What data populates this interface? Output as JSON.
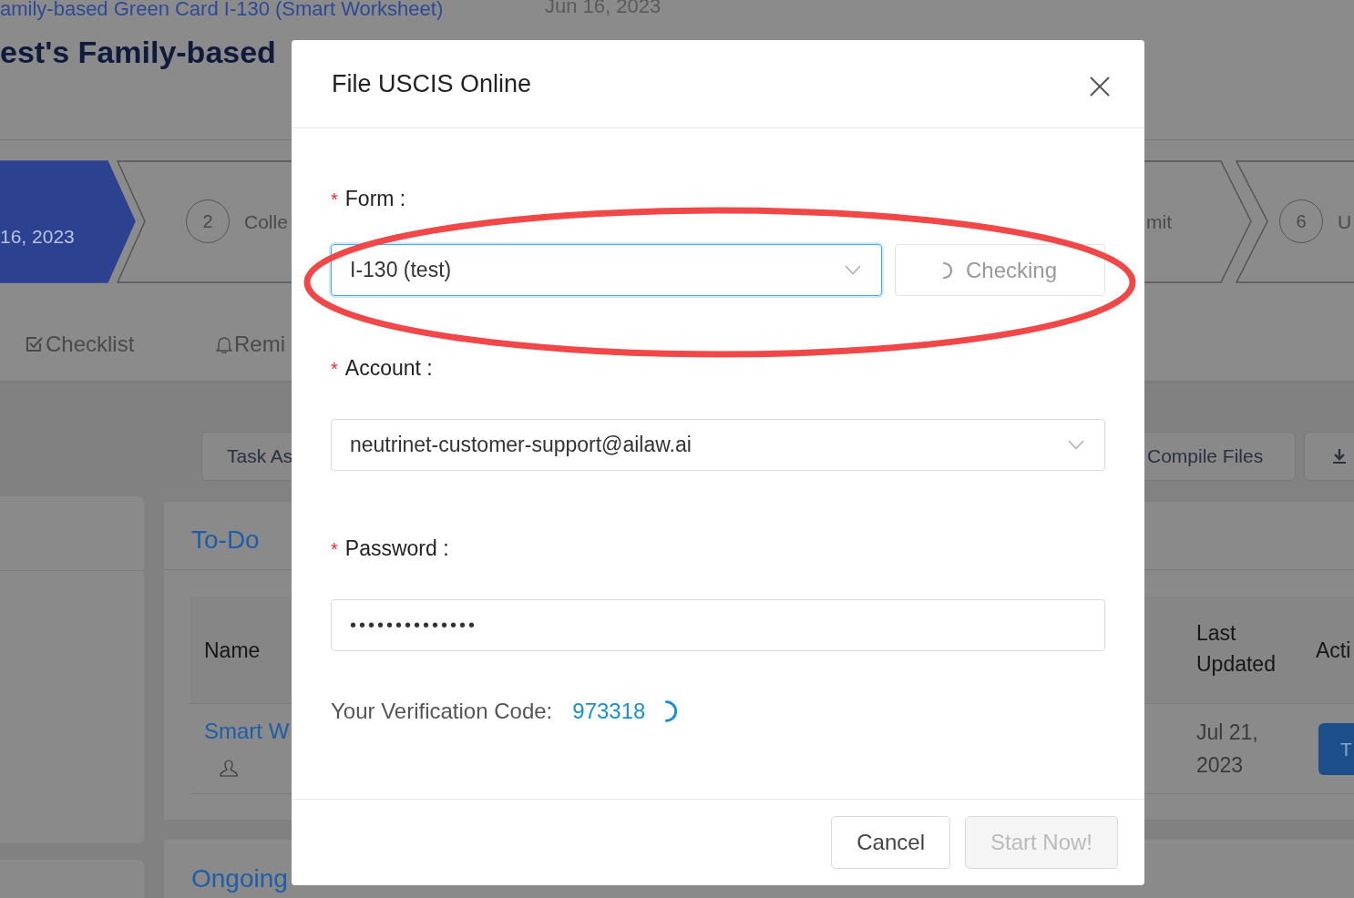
{
  "page": {
    "breadcrumb": "amily-based Green Card I-130 (Smart Worksheet)",
    "breadcrumb_date": "Jun 16, 2023",
    "title": "est's Family-based",
    "steps": [
      {
        "date": "16, 2023",
        "selected": true
      },
      {
        "number": "2",
        "label": "Colle",
        "selected": false
      },
      {
        "label": "mit",
        "selected": false
      },
      {
        "number": "6",
        "label": "U",
        "selected": false
      }
    ],
    "tabs": [
      {
        "label": "Checklist",
        "kind": "checklist"
      },
      {
        "label": "Remi",
        "kind": "reminder"
      }
    ],
    "toolbar": [
      {
        "label": "Task As",
        "kind": "text"
      },
      {
        "label": "Compile Files",
        "kind": "text"
      },
      {
        "kind": "download"
      }
    ],
    "todo": {
      "title": "To-Do",
      "columns": [
        "Name",
        "Last Updated",
        "Acti"
      ],
      "rows": [
        {
          "name": "Smart W",
          "last_updated": "Jul 21, 2023",
          "action": "T"
        }
      ]
    },
    "ongoing": {
      "title": "Ongoing"
    }
  },
  "dialog": {
    "title": "File USCIS Online",
    "form": {
      "required_mark": "*",
      "label": "Form :",
      "value": "I-130 (test)",
      "check_button": {
        "label": "Checking",
        "disabled": true
      }
    },
    "account": {
      "required_mark": "*",
      "label": "Account :",
      "value": "neutrinet-customer-support@ailaw.ai"
    },
    "password": {
      "required_mark": "*",
      "label": "Password :",
      "value": "••••••••••••••"
    },
    "verification": {
      "label": "Your Verification Code:",
      "code": "973318"
    },
    "buttons": [
      {
        "label": "Cancel",
        "disabled": false
      },
      {
        "label": "Start Now!",
        "disabled": true
      }
    ]
  }
}
